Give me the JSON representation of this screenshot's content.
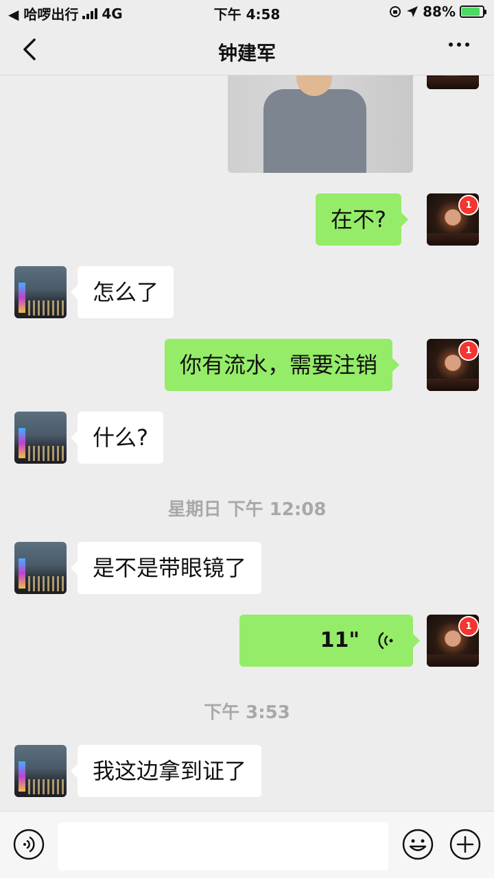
{
  "status_bar": {
    "back_app": "◀ 哈啰出行",
    "network": "4G",
    "time": "下午 4:58",
    "battery_text": "88%",
    "battery_level": 0.88
  },
  "nav": {
    "title": "钟建军"
  },
  "messages": [
    {
      "kind": "image",
      "from": "me"
    },
    {
      "kind": "text",
      "from": "me",
      "text": "在不?",
      "badge": "1"
    },
    {
      "kind": "text",
      "from": "other",
      "text": "怎么了"
    },
    {
      "kind": "text",
      "from": "me",
      "text": "你有流水，需要注销",
      "badge": "1"
    },
    {
      "kind": "text",
      "from": "other",
      "text": "什么?"
    },
    {
      "kind": "timestamp",
      "text": "星期日 下午 12:08"
    },
    {
      "kind": "text",
      "from": "other",
      "text": "是不是带眼镜了"
    },
    {
      "kind": "voice",
      "from": "me",
      "text": "11\"",
      "badge": "1"
    },
    {
      "kind": "timestamp",
      "text": "下午 3:53"
    },
    {
      "kind": "text",
      "from": "other",
      "text": "我这边拿到证了"
    }
  ],
  "input_bar": {
    "placeholder": ""
  },
  "icons": {
    "back": "back-chevron-icon",
    "more": "more-dots-icon",
    "voice_toggle": "voice-input-icon",
    "emoji": "emoji-icon",
    "plus": "plus-icon",
    "voice_wave": "voice-wave-icon"
  },
  "colors": {
    "background": "#ededed",
    "my_bubble": "#95ec69",
    "other_bubble": "#ffffff",
    "badge": "#f43530"
  }
}
